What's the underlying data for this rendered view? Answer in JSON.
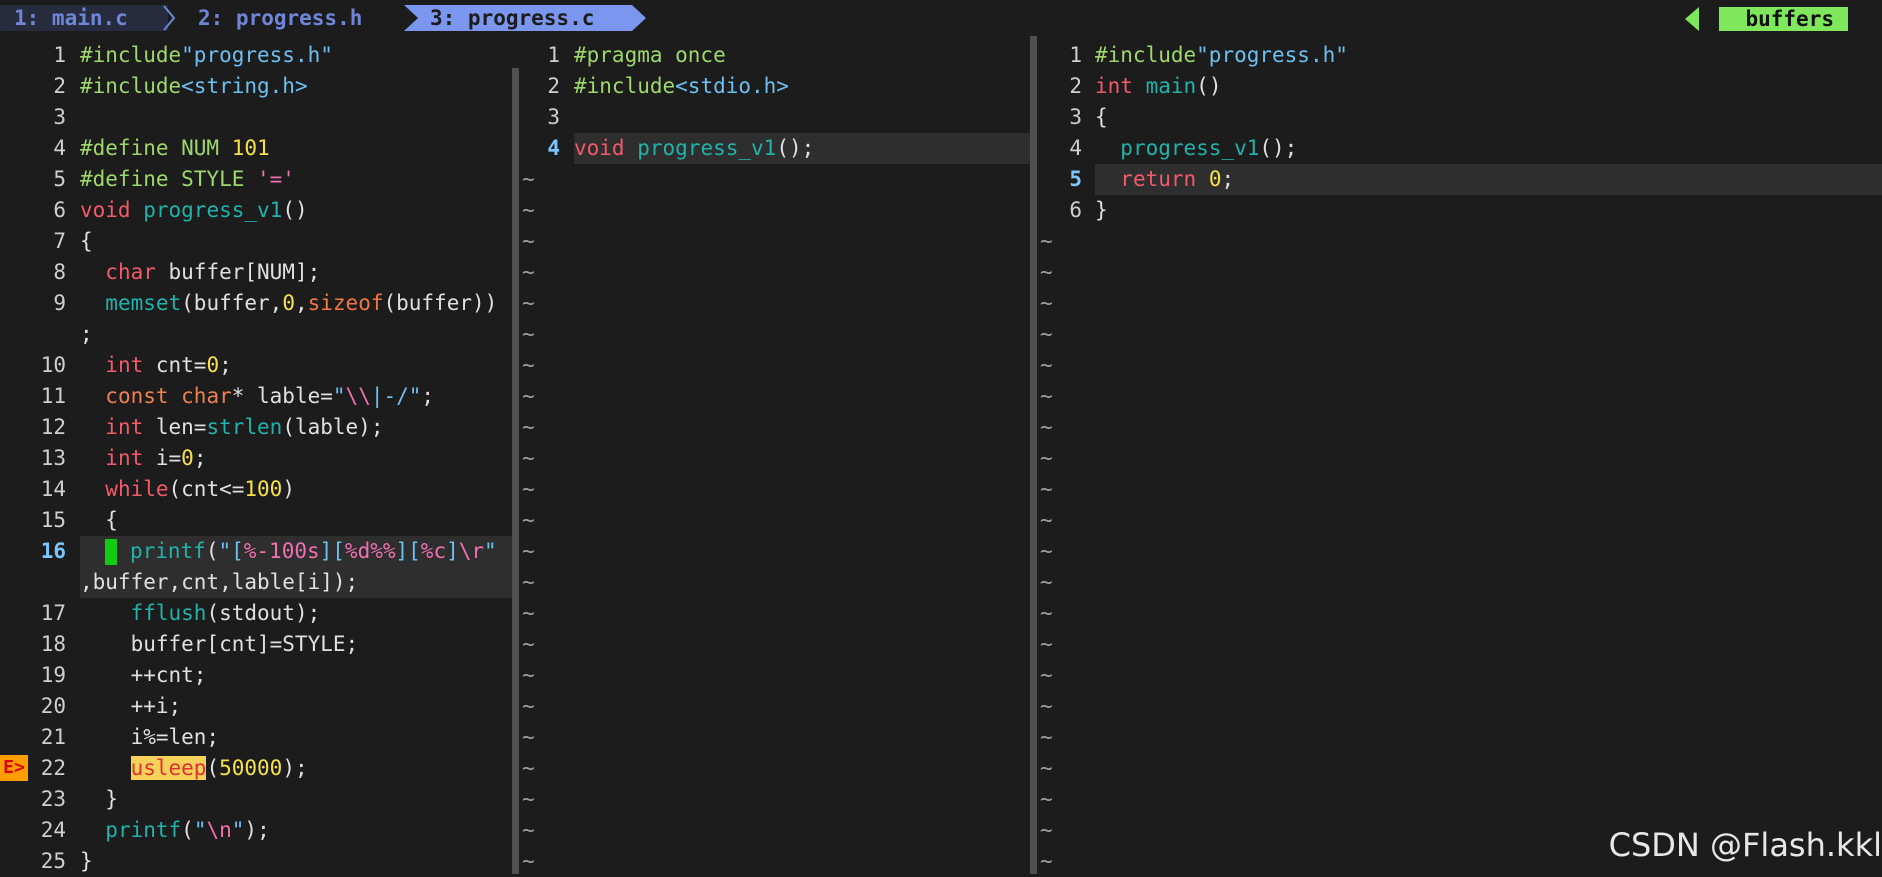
{
  "tabs": [
    {
      "label": "1: main.c"
    },
    {
      "label": "2: progress.h"
    },
    {
      "label": "3: progress.c"
    }
  ],
  "buffers_label": "buffers",
  "pane1": {
    "lines": [
      {
        "n": "1",
        "t": "#include\"progress.h\""
      },
      {
        "n": "2",
        "t": "#include<string.h>"
      },
      {
        "n": "3",
        "t": ""
      },
      {
        "n": "4",
        "t": "#define NUM 101"
      },
      {
        "n": "5",
        "t": "#define STYLE '='"
      },
      {
        "n": "6",
        "t": "void progress_v1()"
      },
      {
        "n": "7",
        "t": "{"
      },
      {
        "n": "8",
        "t": "  char buffer[NUM];"
      },
      {
        "n": "9",
        "t": "  memset(buffer,0,sizeof(buffer))"
      },
      {
        "n": "",
        "t": ";"
      },
      {
        "n": "10",
        "t": "  int cnt=0;"
      },
      {
        "n": "11",
        "t": "  const char* lable=\"\\\\|-/\";"
      },
      {
        "n": "12",
        "t": "  int len=strlen(lable);"
      },
      {
        "n": "13",
        "t": "  int i=0;"
      },
      {
        "n": "14",
        "t": "  while(cnt<=100)"
      },
      {
        "n": "15",
        "t": "  {"
      },
      {
        "n": "16",
        "t": "    printf(\"[%-100s][%d%%][%c]\\r\""
      },
      {
        "n": "",
        "t": ",buffer,cnt,lable[i]);"
      },
      {
        "n": "17",
        "t": "    fflush(stdout);"
      },
      {
        "n": "18",
        "t": "    buffer[cnt]=STYLE;"
      },
      {
        "n": "19",
        "t": "    ++cnt;"
      },
      {
        "n": "20",
        "t": "    ++i;"
      },
      {
        "n": "21",
        "t": "    i%=len;"
      },
      {
        "n": "22",
        "t": "    usleep(50000);"
      },
      {
        "n": "23",
        "t": "  }"
      },
      {
        "n": "24",
        "t": "  printf(\"\\n\");"
      },
      {
        "n": "25",
        "t": "}"
      }
    ],
    "sign": "E>"
  },
  "pane2": {
    "lines": [
      {
        "n": "1",
        "t": "#pragma once"
      },
      {
        "n": "2",
        "t": "#include<stdio.h>"
      },
      {
        "n": "3",
        "t": ""
      },
      {
        "n": "4",
        "t": "void progress_v1();"
      }
    ]
  },
  "pane3": {
    "lines": [
      {
        "n": "1",
        "t": "#include\"progress.h\""
      },
      {
        "n": "2",
        "t": "int main()"
      },
      {
        "n": "3",
        "t": "{"
      },
      {
        "n": "4",
        "t": "  progress_v1();"
      },
      {
        "n": "5",
        "t": "  return 0;"
      },
      {
        "n": "6",
        "t": "}"
      }
    ]
  },
  "tilde": "~",
  "watermark": "CSDN @Flash.kkl",
  "colors": {
    "keyword": "#f2596a",
    "preproc": "#9fd86a",
    "function": "#21b2ab",
    "string": "#6cc0f0",
    "number": "#f7e04d",
    "tab_active": "#7a96ef",
    "buffers_badge": "#7ee75b"
  }
}
